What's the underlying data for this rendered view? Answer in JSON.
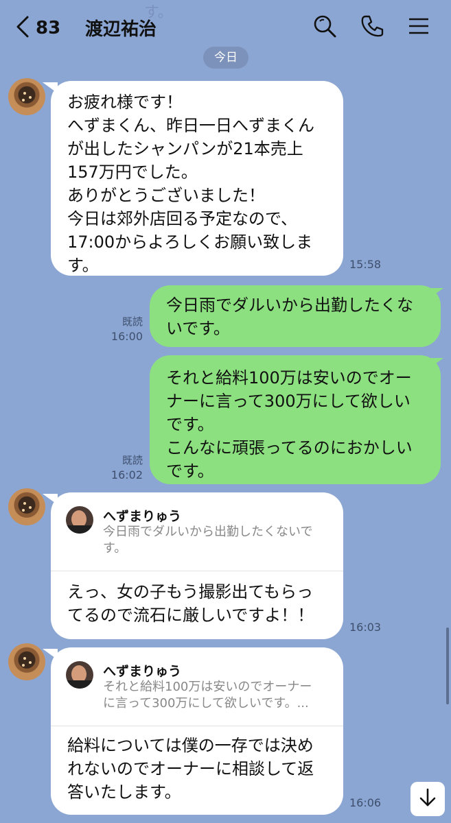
{
  "header": {
    "back_count": "83",
    "title": "渡辺祐治",
    "faded_prev": "す。",
    "icons": [
      "chevron-left-icon",
      "search-icon",
      "phone-icon",
      "menu-icon"
    ]
  },
  "date_divider": "今日",
  "messages": [
    {
      "sender": "them",
      "text": "お疲れ様です！\nへずまくん、昨日一日へずまくん\nが出したシャンパンが21本売上\n157万円でした。\nありがとうございました！\n今日は郊外店回る予定なので、\n17:00からよろしくお願い致しま\nす。",
      "time": "15:58"
    },
    {
      "sender": "me",
      "text": "今日雨でダルいから出勤したくな\nいです。",
      "read": "既読",
      "time": "16:00"
    },
    {
      "sender": "me",
      "text": "それと給料100万は安いのでオー\nナーに言って300万にして欲しい\nです。\nこんなに頑張ってるのにおかしい\nです。",
      "read": "既読",
      "time": "16:02"
    },
    {
      "sender": "them",
      "quote_name": "へずまりゅう",
      "quote_text": "今日雨でダルいから出勤したくないで\nす。",
      "text": "えっ、女の子もう撮影出てもらっ\nてるので流石に厳しいですよ！！",
      "time": "16:03"
    },
    {
      "sender": "them",
      "quote_name": "へずまりゅう",
      "quote_text": "それと給料100万は安いのでオーナー\nに言って300万にして欲しいです。...",
      "text": "給料については僕の一存では決め\nれないのでオーナーに相談して返\n答いたします。",
      "time": "16:06"
    }
  ],
  "colors": {
    "background": "#8ca6d3",
    "my_bubble": "#8ce07f",
    "their_bubble": "#ffffff"
  },
  "scroll_button_icon": "arrow-down-icon"
}
